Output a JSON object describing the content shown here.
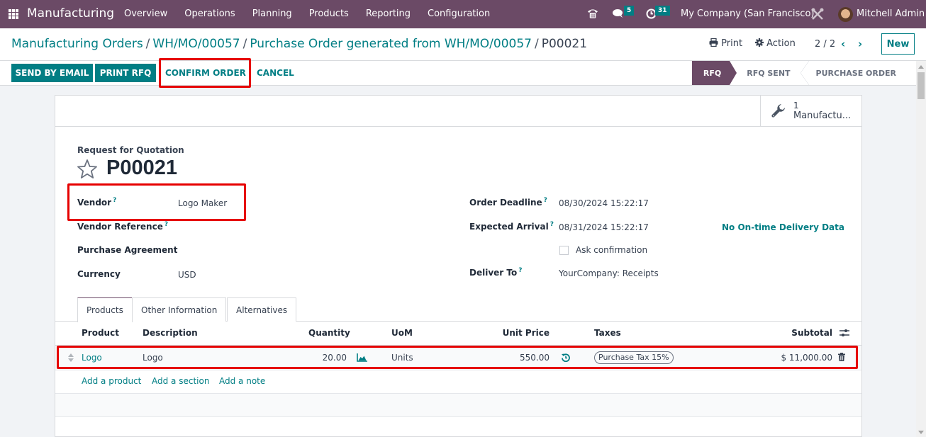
{
  "navbar": {
    "app_name": "Manufacturing",
    "menu": [
      "Overview",
      "Operations",
      "Planning",
      "Products",
      "Reporting",
      "Configuration"
    ],
    "messages_count": "5",
    "activities_count": "31",
    "company": "My Company (San Francisco)",
    "user": "Mitchell Admin",
    "icons": {
      "apps": "grid-icon",
      "phone": "phone-icon",
      "chat": "chat-icon",
      "activity": "clock-icon",
      "debug": "tools-icon"
    }
  },
  "breadcrumb": {
    "items": [
      "Manufacturing Orders",
      "WH/MO/00057",
      "Purchase Order generated from WH/MO/00057"
    ],
    "current": "P00021",
    "separator": "/"
  },
  "control_panel": {
    "print_label": "Print",
    "action_label": "Action",
    "pager": "2 / 2",
    "new_label": "New"
  },
  "statusbar": {
    "buttons": {
      "send_by_email": "SEND BY EMAIL",
      "print_rfq": "PRINT RFQ",
      "confirm_order": "CONFIRM ORDER",
      "cancel": "CANCEL"
    },
    "steps": [
      {
        "label": "RFQ",
        "active": true
      },
      {
        "label": "RFQ SENT",
        "active": false
      },
      {
        "label": "PURCHASE ORDER",
        "active": false
      }
    ]
  },
  "smart_button": {
    "count": "1",
    "label": "Manufactu..."
  },
  "form": {
    "doc_type": "Request for Quotation",
    "name": "P00021",
    "left_fields": {
      "vendor": {
        "label": "Vendor",
        "value": "Logo Maker",
        "help": "?"
      },
      "vendor_reference": {
        "label": "Vendor Reference",
        "value": "",
        "help": "?"
      },
      "purchase_agreement": {
        "label": "Purchase Agreement",
        "value": ""
      },
      "currency": {
        "label": "Currency",
        "value": "USD"
      }
    },
    "right_fields": {
      "order_deadline": {
        "label": "Order Deadline",
        "value": "08/30/2024 15:22:17",
        "help": "?"
      },
      "expected_arrival": {
        "label": "Expected Arrival",
        "value": "08/31/2024 15:22:17",
        "help": "?"
      },
      "ontime_link": "No On-time Delivery Data",
      "ask_confirmation": {
        "label": "Ask confirmation",
        "checked": false
      },
      "deliver_to": {
        "label": "Deliver To",
        "value": "YourCompany: Receipts",
        "help": "?"
      }
    }
  },
  "tabs": [
    "Products",
    "Other Information",
    "Alternatives"
  ],
  "order_lines": {
    "columns": [
      "Product",
      "Description",
      "Quantity",
      "UoM",
      "Unit Price",
      "Taxes",
      "Subtotal"
    ],
    "rows": [
      {
        "product": "Logo",
        "description": "Logo",
        "quantity": "20.00",
        "uom": "Units",
        "unit_price": "550.00",
        "taxes": "Purchase Tax 15%",
        "subtotal": "$ 11,000.00"
      }
    ],
    "add_links": [
      "Add a product",
      "Add a section",
      "Add a note"
    ]
  },
  "colors": {
    "brand": "#6b4a66",
    "accent": "#017e84",
    "highlight": "#e60000"
  }
}
